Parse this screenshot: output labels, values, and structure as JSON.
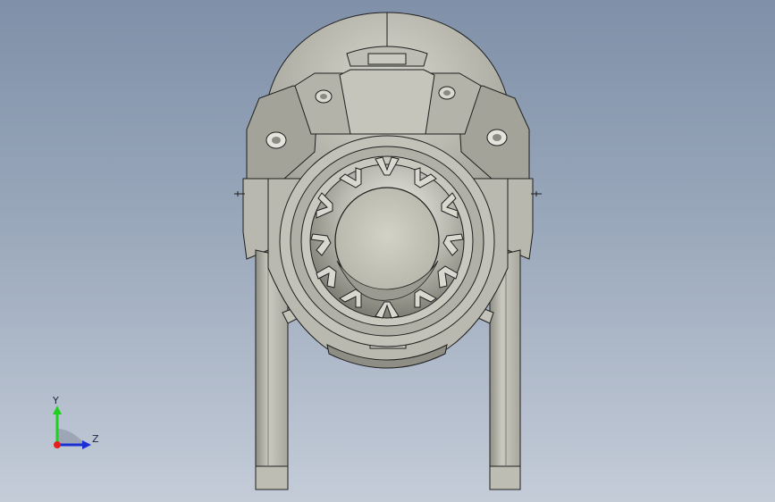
{
  "triad": {
    "y_label": "Y",
    "z_label": "Z",
    "colors": {
      "y": "#1fd11f",
      "z": "#1b2fd6",
      "x": "#e3201b"
    }
  },
  "model": {
    "icon": "cad-part-front-view",
    "body_color": "#c7c7bd",
    "shadow_color": "#8d8d84",
    "edge_color": "#1f1f1f"
  }
}
